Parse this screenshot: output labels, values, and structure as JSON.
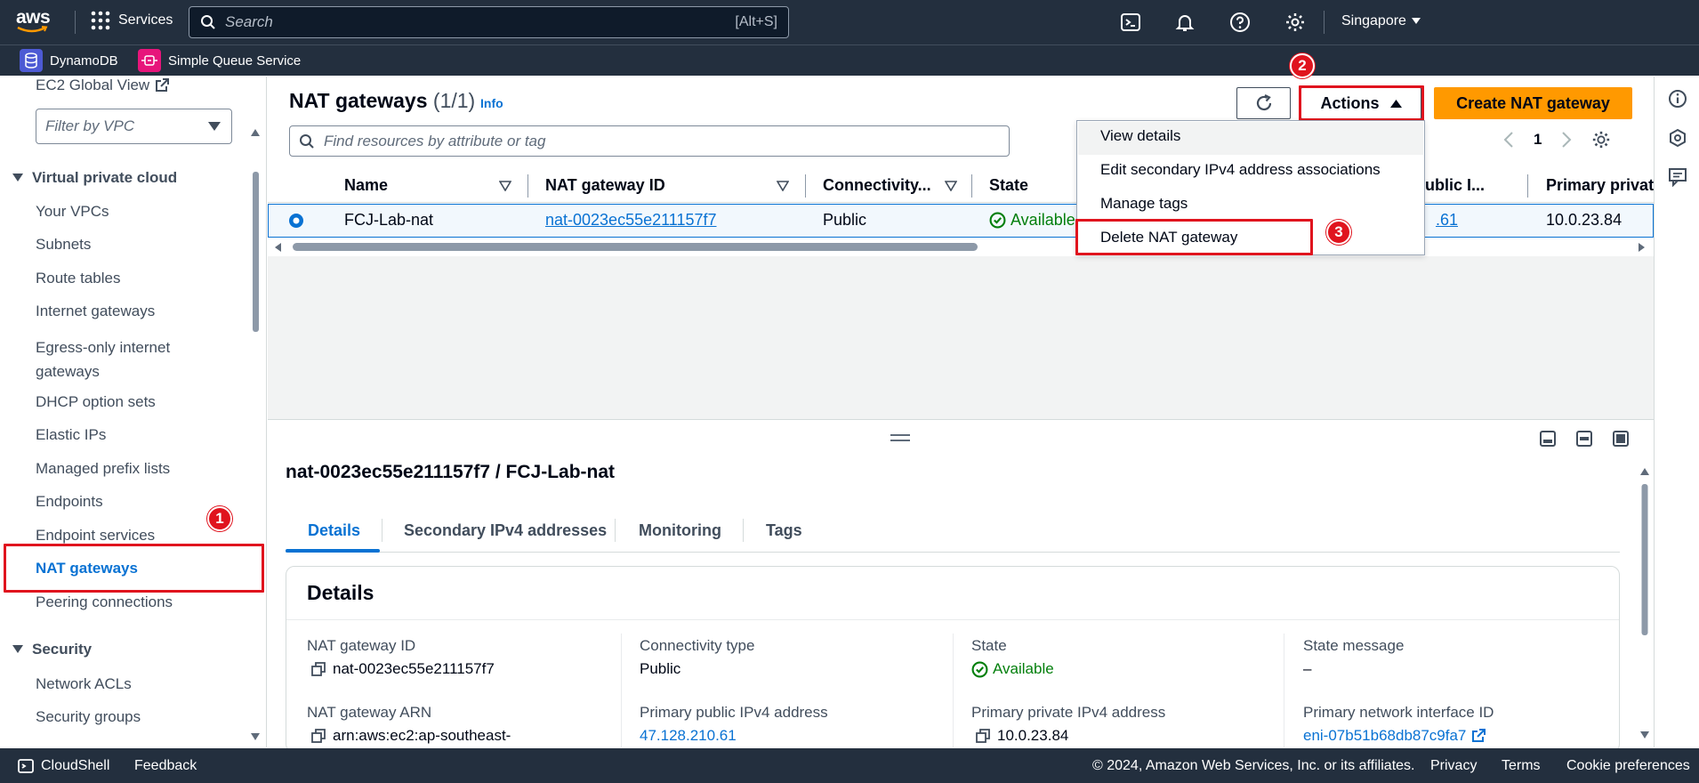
{
  "topbar": {
    "logo": "aws",
    "services_label": "Services",
    "search_placeholder": "Search",
    "search_shortcut": "[Alt+S]",
    "region": "Singapore",
    "icons": [
      "cloudshell-icon",
      "bell-icon",
      "help-icon",
      "gear-icon"
    ]
  },
  "favorites": [
    {
      "label": "DynamoDB",
      "icon": "dynamodb-icon",
      "color": "#4d5ad4"
    },
    {
      "label": "Simple Queue Service",
      "icon": "sqs-icon",
      "color": "#e7157b"
    }
  ],
  "sidebar": {
    "top_link": "EC2 Global View",
    "filter_placeholder": "Filter by VPC",
    "section_vpc": "Virtual private cloud",
    "items": [
      "Your VPCs",
      "Subnets",
      "Route tables",
      "Internet gateways",
      "Egress-only internet",
      "gateways",
      "DHCP option sets",
      "Elastic IPs",
      "Managed prefix lists",
      "Endpoints",
      "Endpoint services",
      "NAT gateways",
      "Peering connections"
    ],
    "section_security": "Security",
    "security_items": [
      "Network ACLs",
      "Security groups"
    ]
  },
  "header": {
    "title": "NAT gateways",
    "count": "(1/1)",
    "info": "Info",
    "actions_label": "Actions",
    "create_label": "Create NAT gateway",
    "search_placeholder": "Find resources by attribute or tag",
    "page": "1"
  },
  "table": {
    "columns": [
      "Name",
      "NAT gateway ID",
      "Connectivity...",
      "State",
      "Primary public I...",
      "Primary private"
    ],
    "col_public_visible": "ublic I...",
    "row": {
      "name": "FCJ-Lab-nat",
      "id": "nat-0023ec55e211157f7",
      "connectivity": "Public",
      "state": "Available",
      "public_ip_visible": ".61",
      "private_ip": "10.0.23.84"
    }
  },
  "dropdown": {
    "items": [
      "View details",
      "Edit secondary IPv4 address associations",
      "Manage tags",
      "Delete NAT gateway"
    ]
  },
  "annotations": {
    "badge1": "1",
    "badge2": "2",
    "badge3": "3"
  },
  "details": {
    "title": "nat-0023ec55e211157f7 / FCJ-Lab-nat",
    "tabs": [
      "Details",
      "Secondary IPv4 addresses",
      "Monitoring",
      "Tags"
    ],
    "card_title": "Details",
    "fields": {
      "nat_id_label": "NAT gateway ID",
      "nat_id_value": "nat-0023ec55e211157f7",
      "conn_label": "Connectivity type",
      "conn_value": "Public",
      "state_label": "State",
      "state_value": "Available",
      "msg_label": "State message",
      "msg_value": "–",
      "arn_label": "NAT gateway ARN",
      "arn_value": "arn:aws:ec2:ap-southeast-",
      "pub_label": "Primary public IPv4 address",
      "pub_value": "47.128.210.61",
      "priv_label": "Primary private IPv4 address",
      "priv_value": "10.0.23.84",
      "eni_label": "Primary network interface ID",
      "eni_value": "eni-07b51b68db87c9fa7"
    }
  },
  "footer": {
    "cloudshell": "CloudShell",
    "feedback": "Feedback",
    "copyright": "© 2024, Amazon Web Services, Inc. or its affiliates.",
    "privacy": "Privacy",
    "terms": "Terms",
    "cookies": "Cookie preferences"
  },
  "colors": {
    "accent": "#0972d3",
    "primary_button": "#ff9900",
    "annotation": "#e0141e",
    "topbar": "#232f3e",
    "success": "#037f0c"
  }
}
